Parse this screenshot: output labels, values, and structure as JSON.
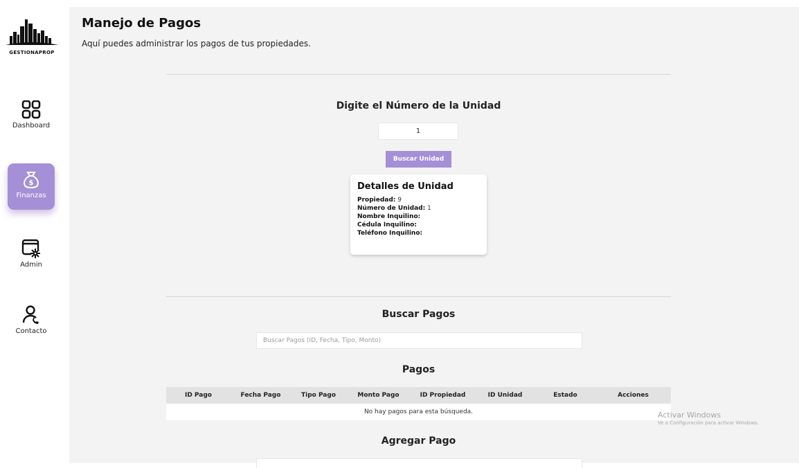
{
  "sidebar": {
    "logo_text": "GESTIONAPROP",
    "items": [
      {
        "label": "Dashboard",
        "icon": "grid-icon",
        "active": false
      },
      {
        "label": "Finanzas",
        "icon": "money-bag-icon",
        "active": true
      },
      {
        "label": "Admin",
        "icon": "window-gear-icon",
        "active": false
      },
      {
        "label": "Contacto",
        "icon": "user-phone-icon",
        "active": false
      }
    ]
  },
  "header": {
    "title": "Manejo de Pagos",
    "subtitle": "Aquí puedes administrar los pagos de tus propiedades."
  },
  "unit_search": {
    "heading": "Digite el Número de la Unidad",
    "input_value": "1",
    "button_label": "Buscar Unidad"
  },
  "unit_details": {
    "title": "Detalles de Unidad",
    "propiedad_label": "Propiedad:",
    "propiedad_value": "9",
    "numero_label": "Número de Unidad:",
    "numero_value": "1",
    "nombre_label": "Nombre Inquilino:",
    "nombre_value": "",
    "cedula_label": "Cédula Inquilino:",
    "cedula_value": "",
    "telefono_label": "Teléfono Inquilino:",
    "telefono_value": ""
  },
  "payments_search": {
    "heading": "Buscar Pagos",
    "placeholder": "Buscar Pagos (ID, Fecha, Tipo, Monto)"
  },
  "payments_table": {
    "heading": "Pagos",
    "columns": [
      "ID Pago",
      "Fecha Pago",
      "Tipo Pago",
      "Monto Pago",
      "ID Propiedad",
      "ID Unidad",
      "Estado",
      "Acciones"
    ],
    "empty_message": "No hay pagos para esta búsqueda."
  },
  "add_payment": {
    "heading": "Agregar Pago"
  },
  "watermark": {
    "line1": "Activar Windows",
    "line2": "Ve a Configuración para activar Windows."
  },
  "colors": {
    "accent": "#a58fd6",
    "background": "#f3f3f3"
  }
}
